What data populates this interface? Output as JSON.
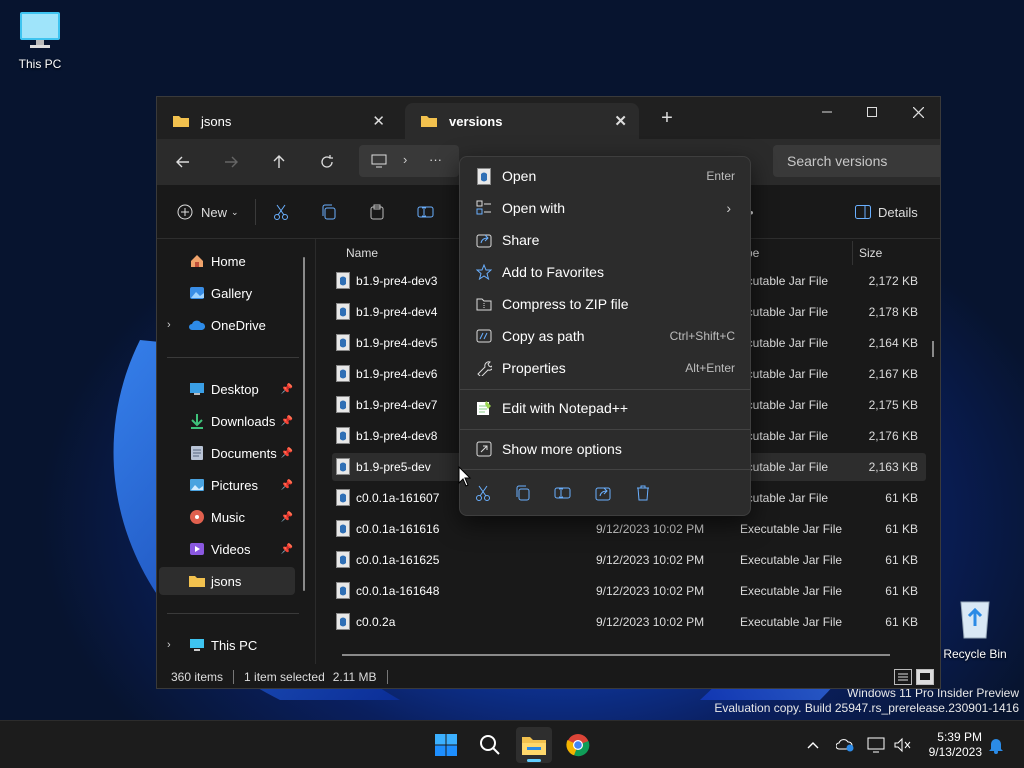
{
  "desktop": {
    "this_pc_label": "This PC",
    "recycle_bin_label": "Recycle Bin",
    "watermark_line1": "Windows 11 Pro Insider Preview",
    "watermark_line2": "Evaluation copy. Build 25947.rs_prerelease.230901-1416"
  },
  "explorer": {
    "tabs": [
      {
        "label": "jsons",
        "close": "✕"
      },
      {
        "label": "versions",
        "close": "✕"
      }
    ],
    "new_tab": "+",
    "search_placeholder": "Search versions",
    "address_more": "···",
    "toolbar": {
      "new_label": "New",
      "details_label": "Details",
      "more": "···"
    },
    "sidebar": {
      "items": [
        {
          "label": "Home",
          "icon": "home-icon"
        },
        {
          "label": "Gallery",
          "icon": "gallery-icon"
        },
        {
          "label": "OneDrive",
          "icon": "onedrive-icon"
        },
        {
          "label": "Desktop",
          "icon": "desktop-icon"
        },
        {
          "label": "Downloads",
          "icon": "downloads-icon"
        },
        {
          "label": "Documents",
          "icon": "documents-icon"
        },
        {
          "label": "Pictures",
          "icon": "pictures-icon"
        },
        {
          "label": "Music",
          "icon": "music-icon"
        },
        {
          "label": "Videos",
          "icon": "videos-icon"
        },
        {
          "label": "jsons",
          "icon": "folder-icon"
        },
        {
          "label": "This PC",
          "icon": "this-pc-icon"
        }
      ]
    },
    "columns": {
      "name": "Name",
      "type": "pe",
      "size": "Size"
    },
    "files": [
      {
        "name": "b1.9-pre4-dev3",
        "date": "",
        "type": "ecutable Jar File",
        "size": "2,172 KB"
      },
      {
        "name": "b1.9-pre4-dev4",
        "date": "",
        "type": "ecutable Jar File",
        "size": "2,178 KB"
      },
      {
        "name": "b1.9-pre4-dev5",
        "date": "",
        "type": "ecutable Jar File",
        "size": "2,164 KB"
      },
      {
        "name": "b1.9-pre4-dev6",
        "date": "",
        "type": "ecutable Jar File",
        "size": "2,167 KB"
      },
      {
        "name": "b1.9-pre4-dev7",
        "date": "",
        "type": "ecutable Jar File",
        "size": "2,175 KB"
      },
      {
        "name": "b1.9-pre4-dev8",
        "date": "",
        "type": "ecutable Jar File",
        "size": "2,176 KB"
      },
      {
        "name": "b1.9-pre5-dev",
        "date": "",
        "type": "ecutable Jar File",
        "size": "2,163 KB"
      },
      {
        "name": "c0.0.1a-161607",
        "date": "",
        "type": "ecutable Jar File",
        "size": "61 KB"
      },
      {
        "name": "c0.0.1a-161616",
        "date": "9/12/2023 10:02 PM",
        "type": "Executable Jar File",
        "size": "61 KB"
      },
      {
        "name": "c0.0.1a-161625",
        "date": "9/12/2023 10:02 PM",
        "type": "Executable Jar File",
        "size": "61 KB"
      },
      {
        "name": "c0.0.1a-161648",
        "date": "9/12/2023 10:02 PM",
        "type": "Executable Jar File",
        "size": "61 KB"
      },
      {
        "name": "c0.0.2a",
        "date": "9/12/2023 10:02 PM",
        "type": "Executable Jar File",
        "size": "61 KB"
      }
    ],
    "status": {
      "count": "360 items",
      "selected": "1 item selected",
      "size": "2.11 MB"
    }
  },
  "context_menu": {
    "items": [
      {
        "label": "Open",
        "shortcut": "Enter"
      },
      {
        "label": "Open with",
        "shortcut": ""
      },
      {
        "label": "Share",
        "shortcut": ""
      },
      {
        "label": "Add to Favorites",
        "shortcut": ""
      },
      {
        "label": "Compress to ZIP file",
        "shortcut": ""
      },
      {
        "label": "Copy as path",
        "shortcut": "Ctrl+Shift+C"
      },
      {
        "label": "Properties",
        "shortcut": "Alt+Enter"
      },
      {
        "label": "Edit with Notepad++",
        "shortcut": ""
      },
      {
        "label": "Show more options",
        "shortcut": ""
      }
    ],
    "submenu_arrow": "›"
  },
  "taskbar": {
    "time": "5:39 PM",
    "date": "9/13/2023"
  },
  "colors": {
    "accent": "#60cdff",
    "folder": "#f2c14e",
    "win11_blue": "#1a63e8"
  }
}
